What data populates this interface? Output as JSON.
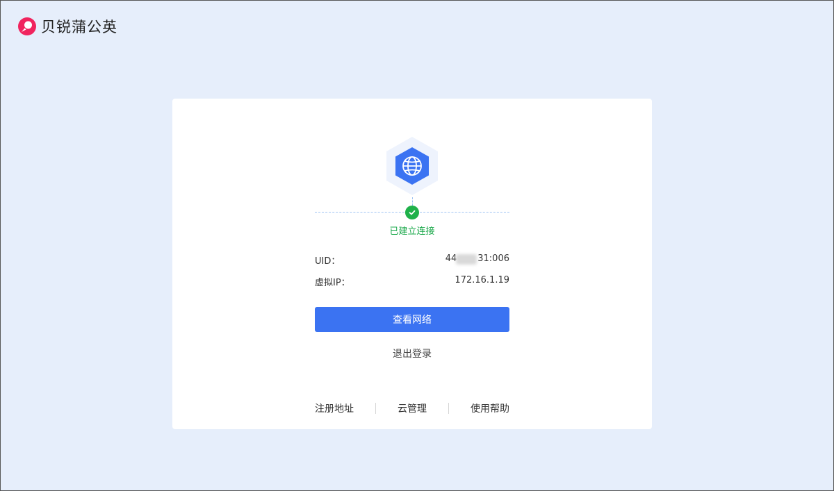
{
  "brand": {
    "name": "贝锐蒲公英",
    "logo_icon": "pgy-logo-icon",
    "color": "#f0245e"
  },
  "connection": {
    "icon": "globe-icon",
    "status_icon": "check-icon",
    "status_text": "已建立连接",
    "status_color": "#1aa84a"
  },
  "info": {
    "uid_label": "UID：",
    "uid_value_prefix": "44",
    "uid_value_suffix": "31:006",
    "vip_label": "虚拟IP：",
    "vip_value": "172.16.1.19"
  },
  "actions": {
    "view_network_label": "查看网络",
    "logout_label": "退出登录",
    "accent_color": "#3b73f2"
  },
  "footer": {
    "links": [
      "注册地址",
      "云管理",
      "使用帮助"
    ]
  }
}
